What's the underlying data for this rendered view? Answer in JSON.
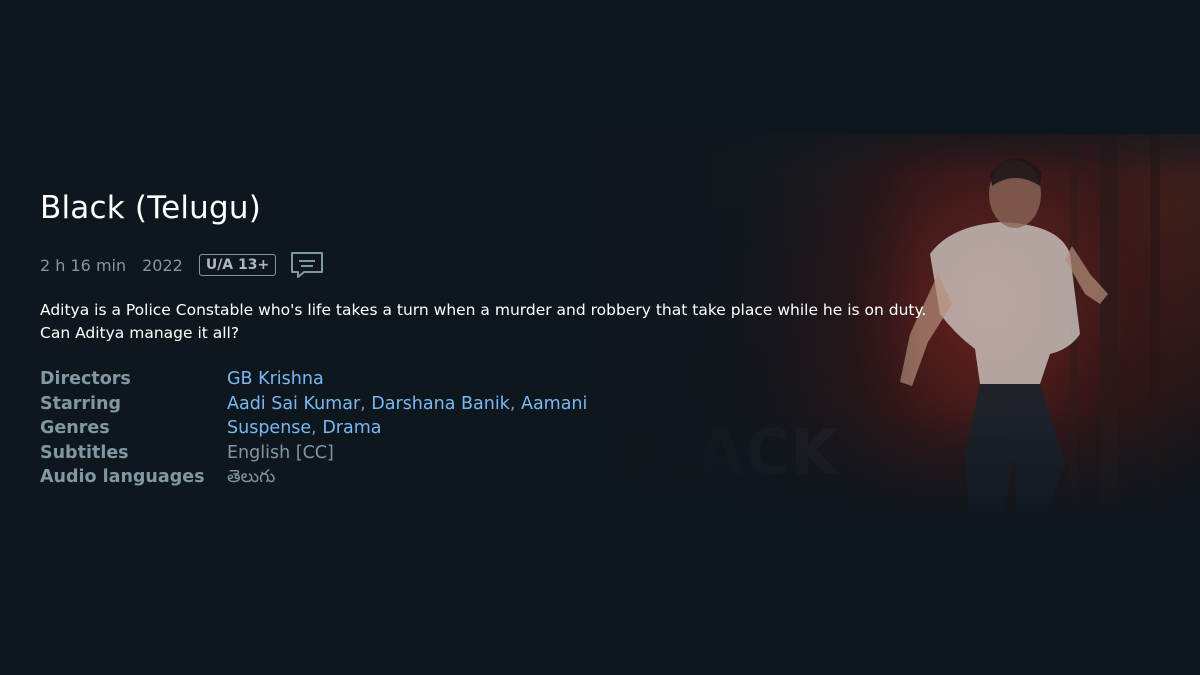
{
  "title": "Black (Telugu)",
  "meta": {
    "runtime": "2 h 16 min",
    "year": "2022",
    "rating": "U/A 13+",
    "subtitles_icon": "subtitles-icon"
  },
  "synopsis_line1": "Aditya is a Police Constable who's life takes a turn when a murder and robbery that take place while he is on duty.",
  "synopsis_line2": "Can Aditya manage it all?",
  "details": {
    "directors_label": "Directors",
    "directors": [
      "GB Krishna"
    ],
    "starring_label": "Starring",
    "starring": [
      "Aadi Sai Kumar",
      "Darshana Banik",
      "Aamani"
    ],
    "genres_label": "Genres",
    "genres": [
      "Suspense",
      "Drama"
    ],
    "subtitles_label": "Subtitles",
    "subtitles_value": "English [CC]",
    "audio_label": "Audio languages",
    "audio_value": "తెలుగు"
  },
  "hero_art_text": "BLACK",
  "colors": {
    "background": "#0f171e",
    "label": "#8197a4",
    "link": "#79b8f3",
    "title": "#ffffff"
  }
}
